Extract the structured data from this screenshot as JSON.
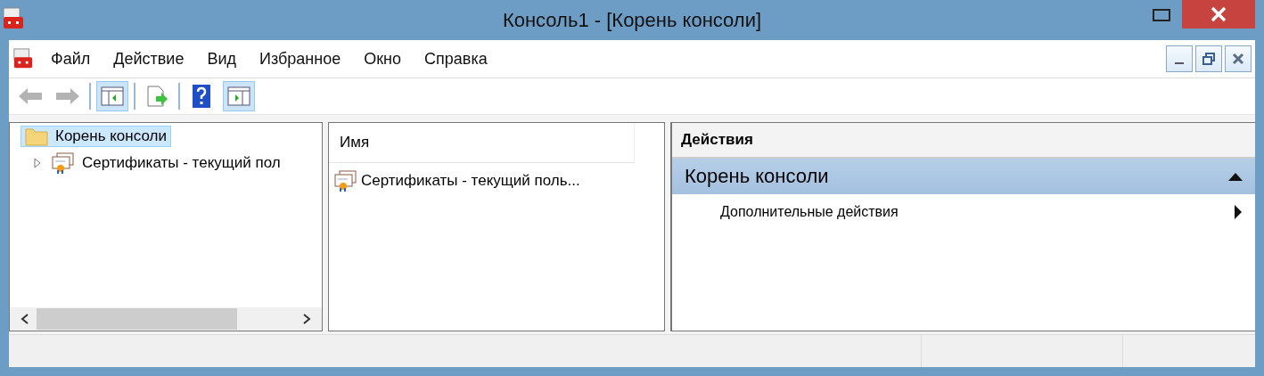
{
  "window": {
    "title": "Консоль1 - [Корень консоли]"
  },
  "menu": [
    {
      "label": "Файл"
    },
    {
      "label": "Действие"
    },
    {
      "label": "Вид"
    },
    {
      "label": "Избранное"
    },
    {
      "label": "Окно"
    },
    {
      "label": "Справка"
    }
  ],
  "toolbar": [
    {
      "kind": "back",
      "disabled": true
    },
    {
      "kind": "forward",
      "disabled": true
    },
    {
      "kind": "separator"
    },
    {
      "kind": "tree-toggle",
      "selected": true
    },
    {
      "kind": "separator"
    },
    {
      "kind": "export",
      "selected": false
    },
    {
      "kind": "separator"
    },
    {
      "kind": "help",
      "selected": false
    },
    {
      "kind": "actions-toggle",
      "selected": true
    }
  ],
  "tree": [
    {
      "label": "Корень консоли",
      "kind": "folder",
      "selected": true,
      "children": [
        {
          "label": "Сертификаты - текущий пол",
          "kind": "certificate",
          "selected": false,
          "expanded": false
        }
      ]
    }
  ],
  "list": {
    "columns": [
      "Имя"
    ],
    "rows": [
      {
        "name": "Сертификаты - текущий поль..."
      }
    ]
  },
  "actions": {
    "header": "Действия",
    "sections": [
      {
        "title": "Корень консоли",
        "expanded": true,
        "items": [
          {
            "label": "Дополнительные действия"
          }
        ]
      }
    ]
  }
}
